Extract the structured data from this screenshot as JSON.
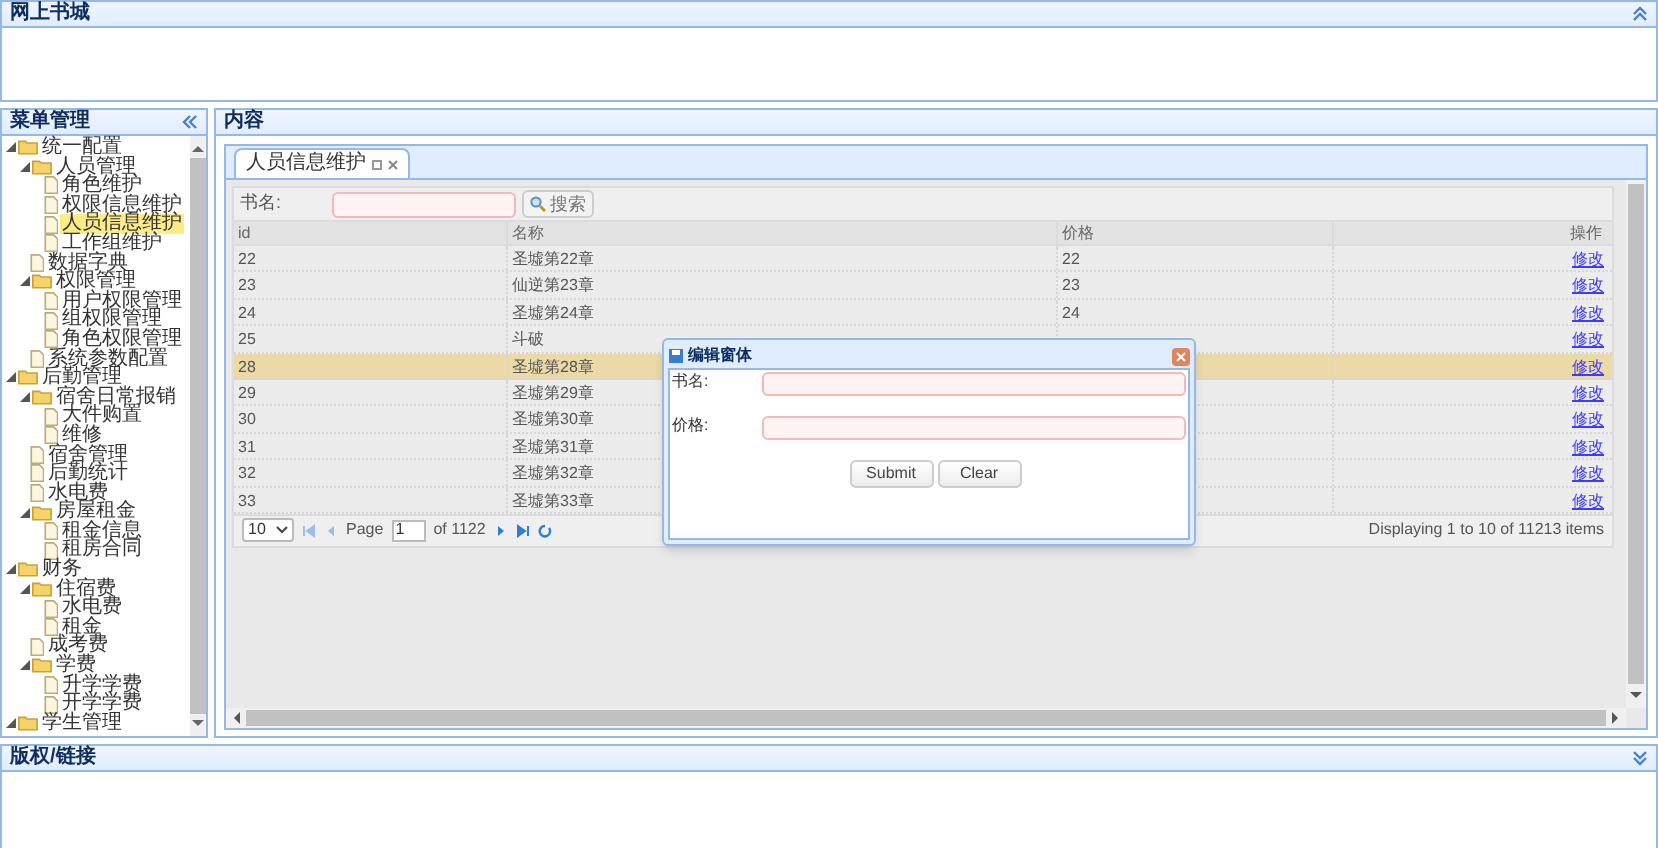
{
  "header": {
    "title": "网上书城"
  },
  "menu": {
    "title": "菜单管理",
    "tree": [
      {
        "label": "统一配置",
        "kind": "folder",
        "expanded": true,
        "selected": false,
        "children": [
          {
            "label": "人员管理",
            "kind": "folder",
            "expanded": true,
            "selected": false,
            "children": [
              {
                "label": "角色维护",
                "kind": "file",
                "selected": false
              },
              {
                "label": "权限信息维护",
                "kind": "file",
                "selected": false
              },
              {
                "label": "人员信息维护",
                "kind": "file",
                "selected": true
              },
              {
                "label": "工作组维护",
                "kind": "file",
                "selected": false
              }
            ]
          },
          {
            "label": "数据字典",
            "kind": "file",
            "selected": false
          },
          {
            "label": "权限管理",
            "kind": "folder",
            "expanded": true,
            "selected": false,
            "children": [
              {
                "label": "用户权限管理",
                "kind": "file",
                "selected": false
              },
              {
                "label": "组权限管理",
                "kind": "file",
                "selected": false
              },
              {
                "label": "角色权限管理",
                "kind": "file",
                "selected": false
              }
            ]
          },
          {
            "label": "系统参数配置",
            "kind": "file",
            "selected": false
          }
        ]
      },
      {
        "label": "后勤管理",
        "kind": "folder",
        "expanded": true,
        "selected": false,
        "children": [
          {
            "label": "宿舍日常报销",
            "kind": "folder",
            "expanded": true,
            "selected": false,
            "children": [
              {
                "label": "大件购置",
                "kind": "file",
                "selected": false
              },
              {
                "label": "维修",
                "kind": "file",
                "selected": false
              }
            ]
          },
          {
            "label": "宿舍管理",
            "kind": "file",
            "selected": false
          },
          {
            "label": "后勤统计",
            "kind": "file",
            "selected": false
          },
          {
            "label": "水电费",
            "kind": "file",
            "selected": false
          },
          {
            "label": "房屋租金",
            "kind": "folder",
            "expanded": true,
            "selected": false,
            "children": [
              {
                "label": "租金信息",
                "kind": "file",
                "selected": false
              },
              {
                "label": "租房合同",
                "kind": "file",
                "selected": false
              }
            ]
          }
        ]
      },
      {
        "label": "财务",
        "kind": "folder",
        "expanded": true,
        "selected": false,
        "children": [
          {
            "label": "住宿费",
            "kind": "folder",
            "expanded": true,
            "selected": false,
            "children": [
              {
                "label": "水电费",
                "kind": "file",
                "selected": false
              },
              {
                "label": "租金",
                "kind": "file",
                "selected": false
              }
            ]
          },
          {
            "label": "成考费",
            "kind": "file",
            "selected": false
          },
          {
            "label": "学费",
            "kind": "folder",
            "expanded": true,
            "selected": false,
            "children": [
              {
                "label": "升学学费",
                "kind": "file",
                "selected": false
              },
              {
                "label": "开学学费",
                "kind": "file",
                "selected": false
              }
            ]
          }
        ]
      },
      {
        "label": "学生管理",
        "kind": "folder",
        "expanded": true,
        "selected": false
      }
    ]
  },
  "content": {
    "title": "内容",
    "tabs": [
      {
        "label": "人员信息维护",
        "selected": true
      }
    ],
    "search": {
      "label": "书名:",
      "button": "搜索"
    },
    "table": {
      "columns": [
        "id",
        "名称",
        "价格",
        "操作"
      ],
      "rows": [
        {
          "id": "22",
          "name": "圣墟第22章",
          "price": "22",
          "action": "修改",
          "selected": false
        },
        {
          "id": "23",
          "name": "仙逆第23章",
          "price": "23",
          "action": "修改",
          "selected": false
        },
        {
          "id": "24",
          "name": "圣墟第24章",
          "price": "24",
          "action": "修改",
          "selected": false
        },
        {
          "id": "25",
          "name": "斗破",
          "action": "修改",
          "selected": false
        },
        {
          "id": "28",
          "name": "圣墟第28章",
          "action": "修改",
          "selected": true
        },
        {
          "id": "29",
          "name": "圣墟第29章",
          "action": "修改",
          "selected": false
        },
        {
          "id": "30",
          "name": "圣墟第30章",
          "action": "修改",
          "selected": false
        },
        {
          "id": "31",
          "name": "圣墟第31章",
          "action": "修改",
          "selected": false
        },
        {
          "id": "32",
          "name": "圣墟第32章",
          "action": "修改",
          "selected": false
        },
        {
          "id": "33",
          "name": "圣墟第33章",
          "action": "修改",
          "selected": false
        }
      ]
    },
    "pager": {
      "page_size": "10",
      "page_label": "Page",
      "page": "1",
      "of": "of 1122",
      "summary": "Displaying 1 to 10 of 11213 items"
    }
  },
  "dialog": {
    "title": "编辑窗体",
    "fields": [
      {
        "label": "书名:"
      },
      {
        "label": "价格:"
      }
    ],
    "buttons": [
      "Submit",
      "Clear"
    ]
  },
  "footer": {
    "title": "版权/链接"
  }
}
